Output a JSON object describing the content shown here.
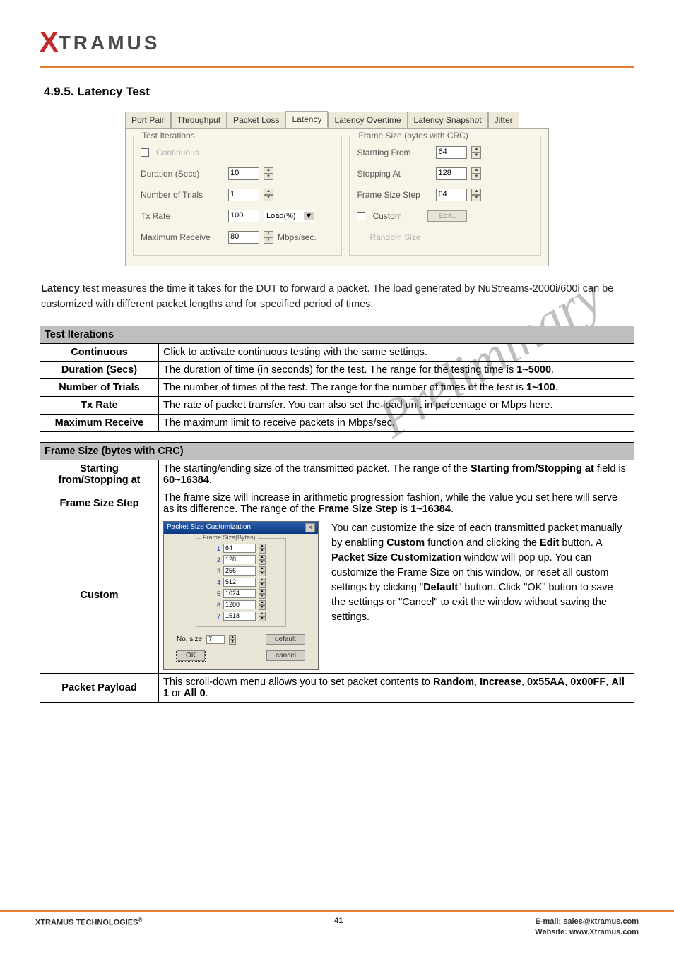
{
  "logo": {
    "x": "X",
    "text": "TRAMUS"
  },
  "section_title": "4.9.5. Latency Test",
  "panel": {
    "tabs": [
      "Port Pair",
      "Throughput",
      "Packet Loss",
      "Latency",
      "Latency Overtime",
      "Latency Snapshot",
      "Jitter"
    ],
    "active_tab": "Latency",
    "left": {
      "legend": "Test Iterations",
      "continuous_label": "Continuous",
      "duration_label": "Duration (Secs)",
      "duration_value": "10",
      "trials_label": "Number of Trials",
      "trials_value": "1",
      "tx_label": "Tx Rate",
      "tx_value": "100",
      "tx_unit": "Load(%)",
      "max_label": "Maximum Receive",
      "max_value": "80",
      "max_unit": "Mbps/sec."
    },
    "right": {
      "legend": "Frame Size (bytes with CRC)",
      "start_label": "Startting From",
      "start_value": "64",
      "stop_label": "Stopping At",
      "stop_value": "128",
      "step_label": "Frame Size Step",
      "step_value": "64",
      "custom_label": "Custom",
      "edit_btn": "Edit..",
      "random_label": "Random Size"
    }
  },
  "intro": {
    "line1_prefix": "Latency",
    "line1_rest": " test measures the time it takes for the DUT to forward a packet. The load generated by NuStreams-2000i/600i can be customized with different packet lengths and for specified period of times."
  },
  "table1": {
    "header": "Test Iterations",
    "rows": [
      {
        "k": "Continuous",
        "v": "Click to activate continuous testing with the same settings."
      },
      {
        "k": "Duration (Secs)",
        "v_prefix": "The duration of time (in seconds) for the test. The range for the testing time is ",
        "v_bold": "1~5000",
        "v_suffix": "."
      },
      {
        "k": "Number of Trials",
        "v_prefix": "The number of times of the test. The range for the number of times of the test is ",
        "v_bold": "1~100",
        "v_suffix": "."
      },
      {
        "k": "Tx Rate",
        "v": "The rate of packet transfer. You can also set the load unit in percentage or Mbps here."
      },
      {
        "k": "Maximum Receive",
        "v": "The maximum limit to receive packets in Mbps/sec."
      }
    ]
  },
  "table2": {
    "header": "Frame Size (bytes with CRC)",
    "rows": {
      "starting": {
        "k": "Starting from/Stopping at",
        "v_a": "The starting/ending size of the transmitted packet. The range of the ",
        "v_b": "Starting from/Stopping at",
        "v_c": " field is ",
        "v_d": "60~16384",
        "v_e": "."
      },
      "step": {
        "k": "Frame Size Step",
        "v_a": "The frame size will increase in arithmetic progression fashion, while the value you set here will serve as its difference. The range of the ",
        "v_b": "Frame Size Step",
        "v_c": " is ",
        "v_d": "1~16384",
        "v_e": "."
      },
      "custom": {
        "k": "Custom",
        "dialog": {
          "title": "Packet Size Customization",
          "fs_legend": "Frame Size(Bytes)",
          "items": [
            {
              "n": "1",
              "v": "64"
            },
            {
              "n": "2",
              "v": "128"
            },
            {
              "n": "3",
              "v": "256"
            },
            {
              "n": "4",
              "v": "512"
            },
            {
              "n": "5",
              "v": "1024"
            },
            {
              "n": "6",
              "v": "1280"
            },
            {
              "n": "7",
              "v": "1518"
            }
          ],
          "no_size_label": "No. size",
          "no_size_value": "7",
          "default_btn": "default",
          "ok_btn": "OK",
          "cancel_btn": "cancel"
        },
        "desc_parts": {
          "p1": "You can customize the size of each transmitted packet manually by enabling ",
          "b1": "Custom",
          "p2": " function and clicking the ",
          "b2": "Edit",
          "p3": " button. A ",
          "b3": "Packet Size Customization",
          "p4": " window will pop up. You can customize the Frame Size on this window, or reset all custom settings by clicking \"",
          "b4": "Default",
          "p5": "\" button. Click \"OK\" button to save the settings or \"Cancel\" to exit the window without saving the settings."
        }
      },
      "payload": {
        "k": "Packet Payload",
        "v_a": "This scroll-down menu allows you to set packet contents to ",
        "b1": "Random",
        "v_b": ", ",
        "b2": "Increase",
        "v_c": ", ",
        "b3": "0x55AA",
        "v_d": ", ",
        "b4": "0x00FF",
        "v_e": ", ",
        "b5": "All 1",
        "v_f": " or ",
        "b6": "All 0",
        "v_g": "."
      }
    }
  },
  "watermark_text": "Preliminary",
  "footer": {
    "left": "XTRAMUS TECHNOLOGIES",
    "reg": "®",
    "page": "41",
    "email_label": "E-mail: ",
    "email": "sales@xtramus.com",
    "web_label": "Website:  ",
    "web": "www.Xtramus.com"
  }
}
